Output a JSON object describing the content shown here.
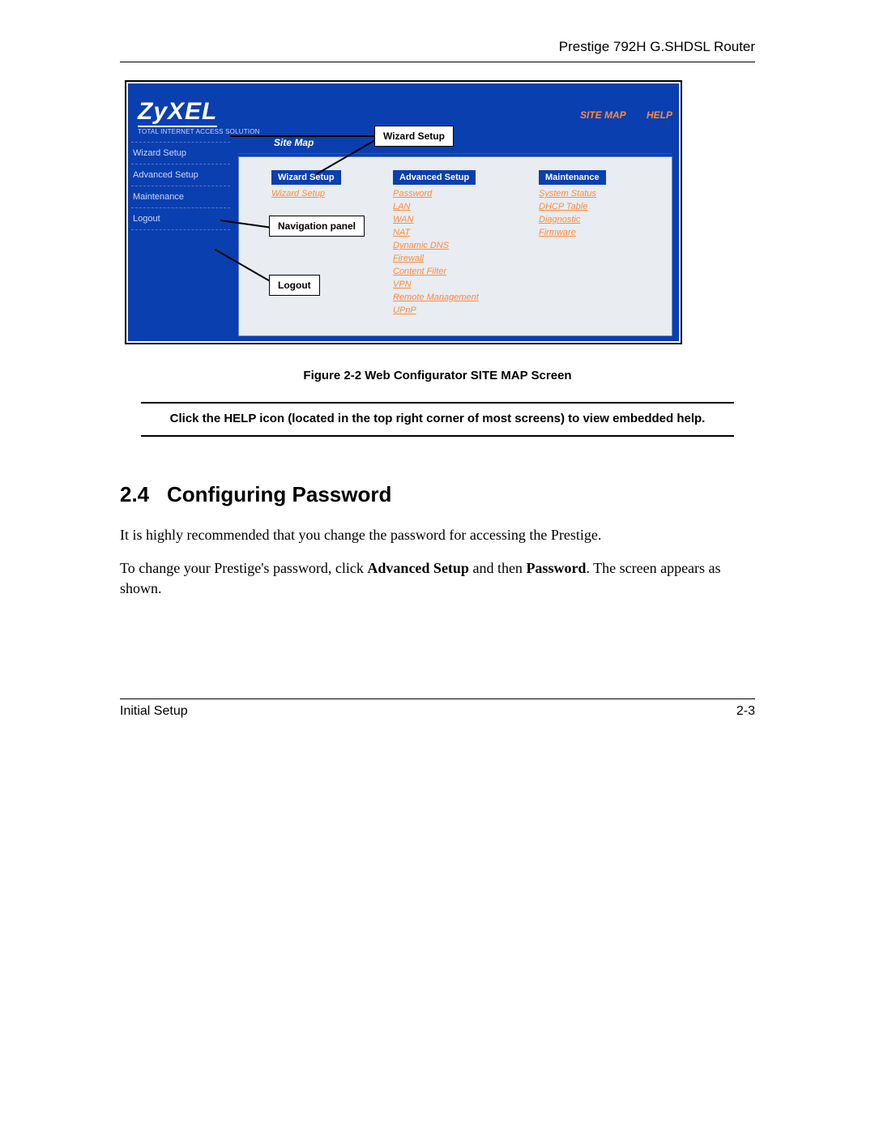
{
  "header": {
    "title": "Prestige 792H G.SHDSL Router"
  },
  "screenshot": {
    "logo_brand": "ZyXEL",
    "logo_tagline": "Total Internet Access Solution",
    "top_links": {
      "sitemap": "SITE MAP",
      "help": "HELP"
    },
    "content_title": "Site Map",
    "sidebar": [
      "Wizard Setup",
      "Advanced Setup",
      "Maintenance",
      "Logout"
    ],
    "columns": {
      "wizard": {
        "head": "Wizard Setup",
        "items": [
          "Wizard Setup"
        ]
      },
      "advanced": {
        "head": "Advanced Setup",
        "items": [
          "Password",
          "LAN",
          "WAN",
          "NAT",
          "Dynamic DNS",
          "Firewall",
          "Content Filter",
          "VPN",
          "Remote Management",
          "UPnP"
        ]
      },
      "maint": {
        "head": "Maintenance",
        "items": [
          "System Status",
          "DHCP Table",
          "Diagnostic",
          "Firmware"
        ]
      }
    }
  },
  "callouts": {
    "wizard_setup": "Wizard Setup",
    "nav_panel": "Navigation panel",
    "logout": "Logout"
  },
  "figure_caption": "Figure 2-2 Web Configurator SITE MAP Screen",
  "tip_text": "Click the HELP icon (located in the top right corner of most screens) to view embedded help.",
  "section": {
    "number": "2.4",
    "title": "Configuring Password"
  },
  "body": {
    "p1": "It is highly recommended that you change the password for accessing the Prestige.",
    "p2a": "To change your Prestige's password, click ",
    "p2b": "Advanced Setup",
    "p2c": " and then ",
    "p2d": "Password",
    "p2e": ". The screen appears as shown."
  },
  "footer": {
    "left": "Initial Setup",
    "right": "2-3"
  }
}
